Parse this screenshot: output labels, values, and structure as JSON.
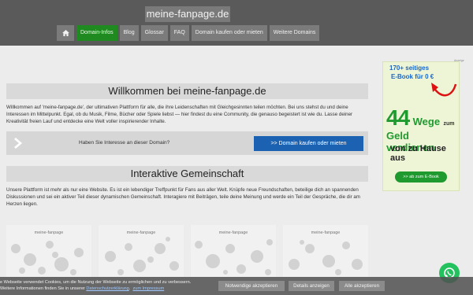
{
  "header": {
    "site_title": "meine-fanpage.de",
    "nav": [
      {
        "label": "Domain-Infos",
        "active": true
      },
      {
        "label": "Blog"
      },
      {
        "label": "Glossar"
      },
      {
        "label": "FAQ"
      },
      {
        "label": "Domain kaufen oder mieten"
      },
      {
        "label": "Weitere Domains"
      }
    ],
    "home_icon": "home-icon"
  },
  "main": {
    "welcome_heading": "Willkommen bei meine-fanpage.de",
    "welcome_text": "Willkommen auf 'meine-fanpage.de', der ultimativen Plattform für alle, die ihre Leidenschaften mit Gleichgesinnten teilen möchten. Bei uns stehst du und deine Interessen im Mittelpunkt. Egal, ob du Musik, Filme, Bücher oder Spiele liebst — hier findest du eine Community, die genauso begeistert ist wie du. Lasse deiner Kreativität freien Lauf und entdecke eine Welt voller inspirierender Inhalte.",
    "domain_question": "Haben Sie Interesse an dieser Domain?",
    "domain_button": ">> Domain kaufen oder mieten",
    "community_heading": "Interaktive Gemeinschaft",
    "community_text": "Unsere Plattform ist mehr als nur eine Website. Es ist ein lebendiger Treffpunkt für Fans aus aller Welt. Knüpfe neue Freundschaften, beteilige dich an spannenden Diskussionen und sei ein aktiver Teil dieser dynamischen Gemeinschaft. Interagiere mit Beiträgen, teile deine Meinung und werde ein Teil der Gespräche, die dir am Herzen liegen.",
    "thumbnails": [
      "meine-fanpage",
      "meine-fanpage",
      "meine-fanpage",
      "meine-fanpage"
    ]
  },
  "ad": {
    "tag": "Anzeige",
    "line1": "170+ seitiges",
    "line2": "E-Book für 0 €",
    "big_number": "44",
    "wege": "Wege",
    "zum": "zum",
    "geld": "Geld verdienen",
    "haus": "von zu Hause aus",
    "button": ">> ab zum E-Book",
    "colors": {
      "green": "#1f9a2f",
      "blue": "#1a66c9"
    }
  },
  "cookie": {
    "line1": "e Webseite verwendet Cookies, um die Nutzung der Webseite zu ermöglichen und zu verbessern.",
    "line2_prefix": "Weitere Informationen finden Sie in unserer",
    "privacy_link": "Datenschutzerklärung",
    "imprint_link": "zum Impressum",
    "buttons": {
      "necessary": "Notwendige akzeptieren",
      "details": "Details anzeigen",
      "all": "Alle akzeptieren"
    }
  }
}
